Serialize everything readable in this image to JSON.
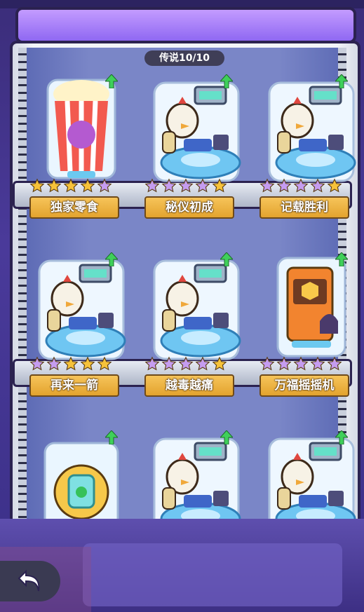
{
  "header": {
    "legend_progress": "传说10/10"
  },
  "items": [
    {
      "name": "独家零食",
      "stars": [
        "gold",
        "gold",
        "gold",
        "gold",
        "purple"
      ],
      "art": "popcorn-icon"
    },
    {
      "name": "秘仪初成",
      "stars": [
        "purple",
        "purple",
        "purple",
        "purple",
        "gold"
      ],
      "art": "robot-chicken-icon"
    },
    {
      "name": "记载胜利",
      "stars": [
        "purple",
        "purple",
        "purple",
        "purple",
        "gold"
      ],
      "art": "robot-chicken-icon"
    },
    {
      "name": "再来一箭",
      "stars": [
        "purple",
        "purple",
        "gold",
        "gold",
        "gold"
      ],
      "art": "robot-chicken-icon"
    },
    {
      "name": "越毒越痛",
      "stars": [
        "purple",
        "purple",
        "purple",
        "purple",
        "gold"
      ],
      "art": "robot-chicken-icon"
    },
    {
      "name": "万福摇摇机",
      "stars": [
        "purple",
        "purple",
        "purple",
        "purple",
        "purple"
      ],
      "art": "slot-machine-icon"
    },
    {
      "name": "",
      "stars": [],
      "art": "gadget-icon"
    },
    {
      "name": "",
      "stars": [],
      "art": "robot-chicken-icon"
    },
    {
      "name": "",
      "stars": [],
      "art": "robot-chicken-icon"
    }
  ],
  "colors": {
    "gold_star": "#f6c23a",
    "purple_star": "#c59cf0",
    "upgrade_arrow": "#3fd05a"
  }
}
